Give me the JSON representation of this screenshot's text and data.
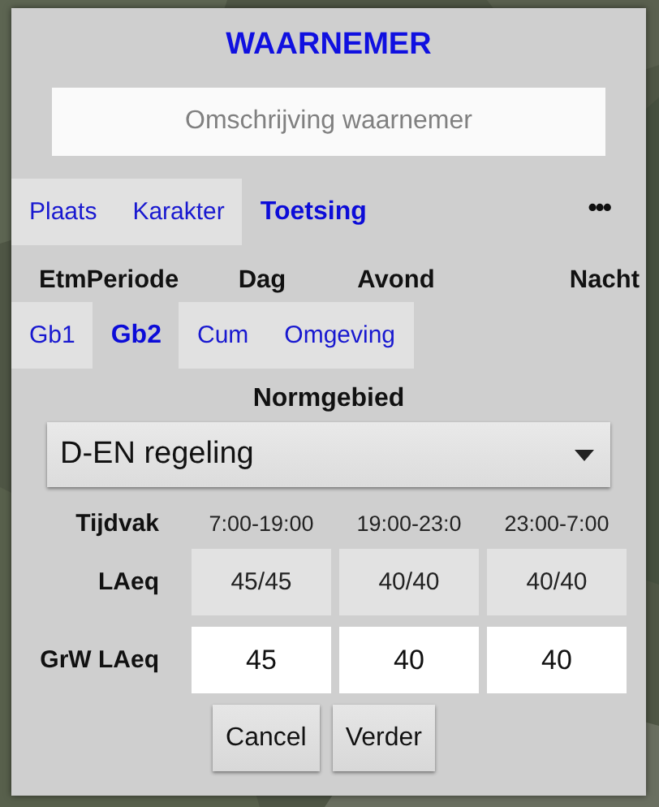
{
  "title": "WAARNEMER",
  "description_field": {
    "placeholder": "Omschrijving waarnemer"
  },
  "tabs": [
    {
      "label": "Plaats",
      "selected": false
    },
    {
      "label": "Karakter",
      "selected": false
    },
    {
      "label": "Toetsing",
      "selected": true
    }
  ],
  "more_button": "•••",
  "period_header": [
    "EtmPeriode",
    "Dag",
    "Avond",
    "Nacht"
  ],
  "sub_tabs": [
    {
      "label": "Gb1",
      "selected": false
    },
    {
      "label": "Gb2",
      "selected": true
    },
    {
      "label": "Cum",
      "selected": false
    },
    {
      "label": "Omgeving",
      "selected": false
    }
  ],
  "normgebied": {
    "label": "Normgebied",
    "value": "D-EN regeling"
  },
  "rows": [
    {
      "kind": "text",
      "label": "Tijdvak",
      "cells": [
        "7:00-19:00",
        "19:00-23:0",
        "23:00-7:00"
      ]
    },
    {
      "kind": "readonly",
      "label": "LAeq",
      "cells": [
        "45/45",
        "40/40",
        "40/40"
      ]
    },
    {
      "kind": "input",
      "label": "GrW LAeq",
      "cells": [
        "45",
        "40",
        "40"
      ]
    }
  ],
  "buttons": [
    "Cancel",
    "Verder"
  ]
}
